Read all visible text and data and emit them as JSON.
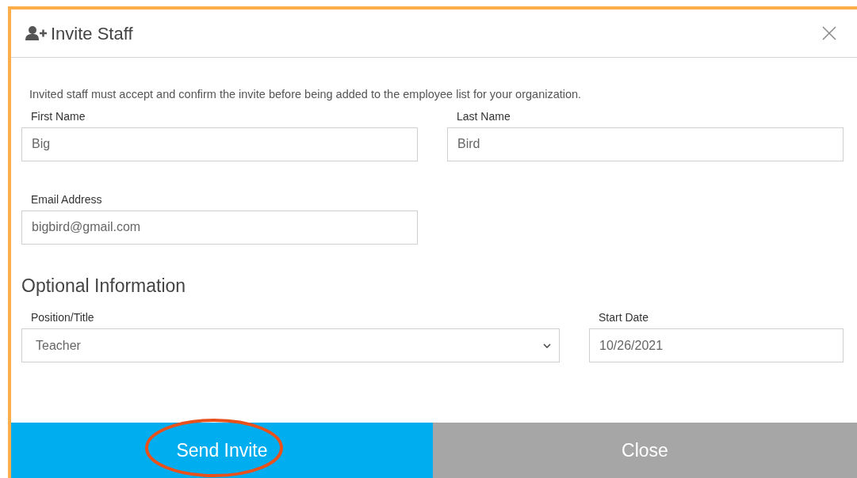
{
  "dialog": {
    "title": "Invite Staff",
    "description": "Invited staff must accept and confirm the invite before being added to the employee list for your organization.",
    "fields": [
      {
        "label": "First Name",
        "value": "Big"
      },
      {
        "label": "Last Name",
        "value": "Bird"
      },
      {
        "label": "Email Address",
        "value": "bigbird@gmail.com"
      }
    ],
    "optional_heading": "Optional Information",
    "position": {
      "label": "Position/Title",
      "value": "Teacher"
    },
    "start_date": {
      "label": "Start Date",
      "value": "10/26/2021"
    },
    "buttons": [
      {
        "label": "Send Invite",
        "kind": "primary",
        "circled": true
      },
      {
        "label": "Close",
        "kind": "secondary",
        "circled": false
      }
    ]
  }
}
